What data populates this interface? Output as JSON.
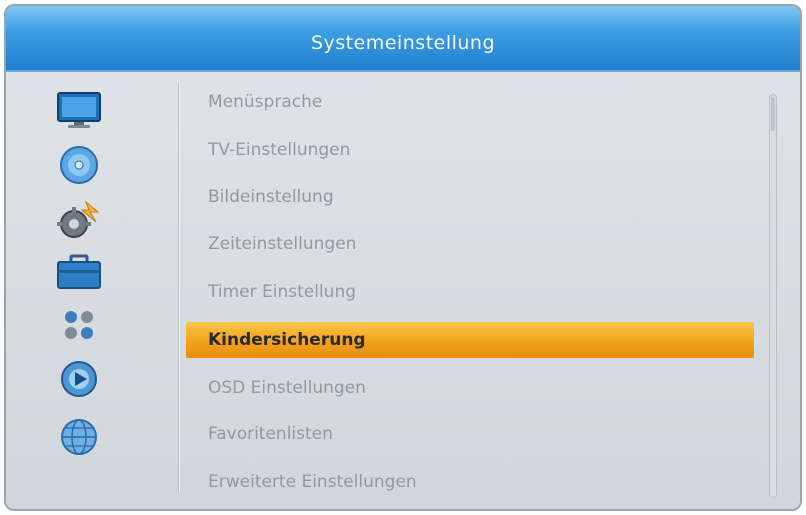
{
  "window": {
    "title": "Systemeinstellung"
  },
  "sidebar": {
    "icons": [
      {
        "name": "tv-monitor-icon"
      },
      {
        "name": "disc-icon"
      },
      {
        "name": "system-gear-icon"
      },
      {
        "name": "toolbox-icon"
      },
      {
        "name": "games-icon"
      },
      {
        "name": "media-player-icon"
      },
      {
        "name": "network-globe-icon"
      }
    ]
  },
  "menu": {
    "selected_index": 5,
    "items": [
      {
        "label": "Menüsprache"
      },
      {
        "label": "TV-Einstellungen"
      },
      {
        "label": "Bildeinstellung"
      },
      {
        "label": "Zeiteinstellungen"
      },
      {
        "label": "Timer Einstellung"
      },
      {
        "label": "Kindersicherung"
      },
      {
        "label": "OSD Einstellungen"
      },
      {
        "label": "Favoritenlisten"
      },
      {
        "label": "Erweiterte Einstellungen"
      }
    ]
  },
  "colors": {
    "title_bar": "#3d9ee3",
    "highlight": "#f3a21d",
    "background": "#d1d6da",
    "inactive_text": "#8e9aa3"
  }
}
